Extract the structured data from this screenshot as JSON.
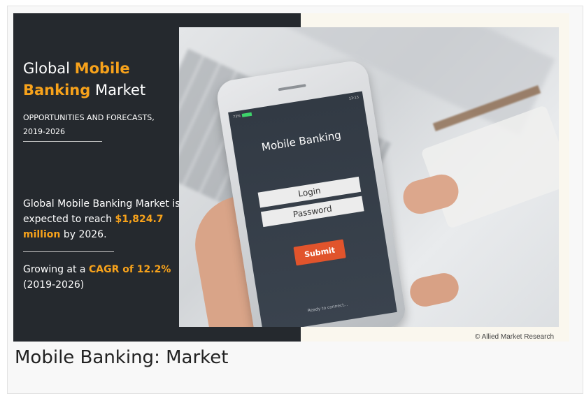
{
  "infographic": {
    "title_part1": "Global ",
    "title_highlight1": "Mobile",
    "title_highlight2": "Banking",
    "title_part2": " Market",
    "subtitle": "Opportunities and Forecasts,",
    "subtitle_years": "2019-2026",
    "stat1_text": "Global Mobile Banking Market  is expected to reach ",
    "stat1_value": "$1,824.7  million",
    "stat1_suffix": " by 2026.",
    "stat2_prefix": "Growing at a ",
    "stat2_value": "CAGR of 12.2%",
    "stat2_years": "(2019-2026)",
    "highlight_color": "#f7a21b",
    "panel_color": "#25292e"
  },
  "phone": {
    "battery": "73%",
    "clock": "13:13",
    "app_title": "Mobile Banking",
    "login_label": "Login",
    "password_label": "Password",
    "submit_label": "Submit",
    "ready_text": "Ready to connect...",
    "submit_color": "#e1542c"
  },
  "copyright": "© Allied Market Research",
  "caption": "Mobile Banking: Market"
}
